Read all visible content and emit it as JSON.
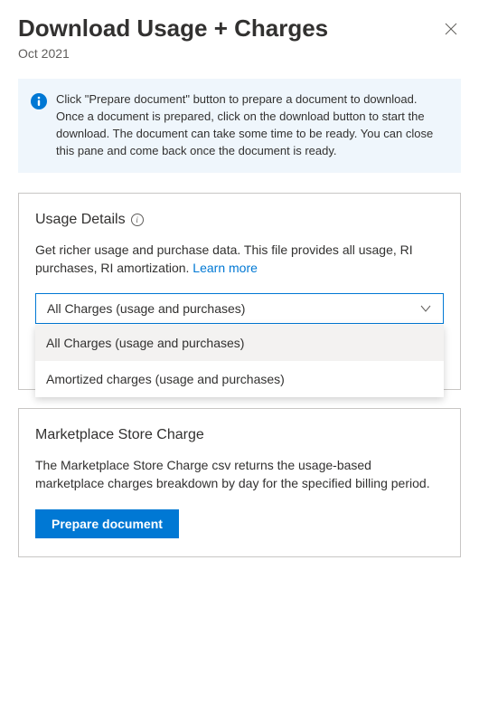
{
  "header": {
    "title": "Download Usage + Charges",
    "subtitle": "Oct 2021"
  },
  "info_banner": {
    "text": "Click \"Prepare document\" button to prepare a document to download. Once a document is prepared, click on the download button to start the download. The document can take some time to be ready. You can close this pane and come back once the document is ready."
  },
  "usage_details": {
    "title": "Usage Details",
    "description": "Get richer usage and purchase data. This file provides all usage, RI purchases, RI amortization. ",
    "learn_more": "Learn more",
    "dropdown": {
      "selected": "All Charges (usage and purchases)",
      "options": [
        "All Charges (usage and purchases)",
        "Amortized charges (usage and purchases)"
      ]
    }
  },
  "marketplace": {
    "title": "Marketplace Store Charge",
    "description": "The Marketplace Store Charge csv returns the usage-based marketplace charges breakdown by day for the specified billing period.",
    "button_label": "Prepare document"
  }
}
